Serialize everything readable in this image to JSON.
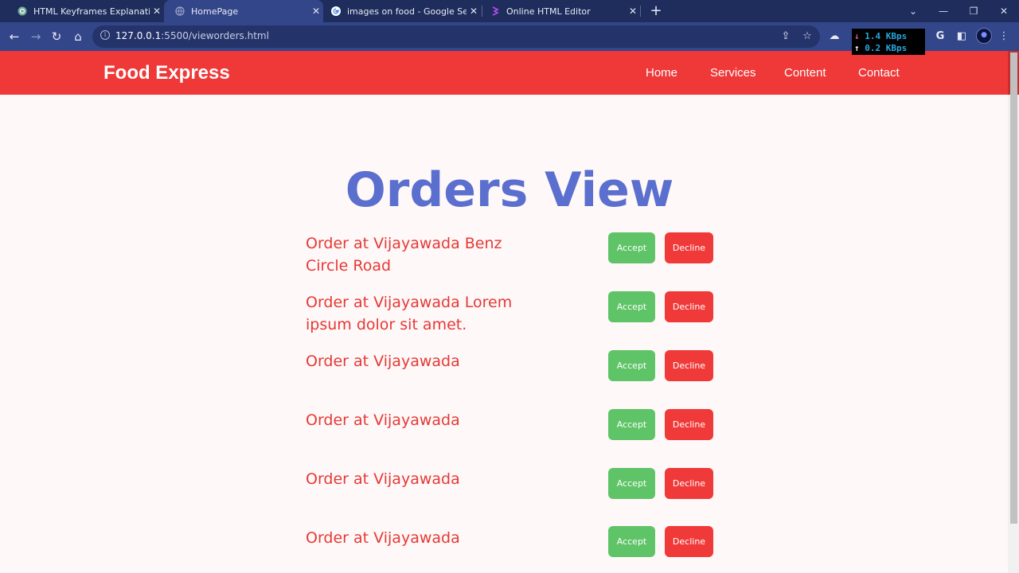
{
  "browser": {
    "tabs": [
      {
        "title": "HTML Keyframes Explanation",
        "icon": "openai-icon",
        "active": false
      },
      {
        "title": "HomePage",
        "icon": "globe-icon",
        "active": true
      },
      {
        "title": "images on food - Google Search",
        "icon": "google-icon",
        "active": false
      },
      {
        "title": "Online HTML Editor",
        "icon": "editor-icon",
        "active": false
      }
    ],
    "url_host": "127.0.0.1",
    "url_rest": ":5500/vieworders.html",
    "speed_down": "1.4 KBps",
    "speed_up": "0.2 KBps"
  },
  "site": {
    "brand": "Food Express",
    "nav": [
      "Home",
      "Services",
      "Content",
      "Contact"
    ]
  },
  "page": {
    "title": "Orders View",
    "accept_label": "Accept",
    "decline_label": "Decline",
    "orders": [
      "Order at Vijayawada Benz Circle Road",
      "Order at Vijayawada Lorem ipsum dolor sit amet.",
      "Order at Vijayawada",
      "Order at Vijayawada",
      "Order at Vijayawada",
      "Order at Vijayawada"
    ]
  },
  "colors": {
    "navbar": "#ef3838",
    "title": "#5b6fcf",
    "order_text": "#e53935",
    "accept": "#5fc467",
    "decline": "#f03a3a"
  }
}
